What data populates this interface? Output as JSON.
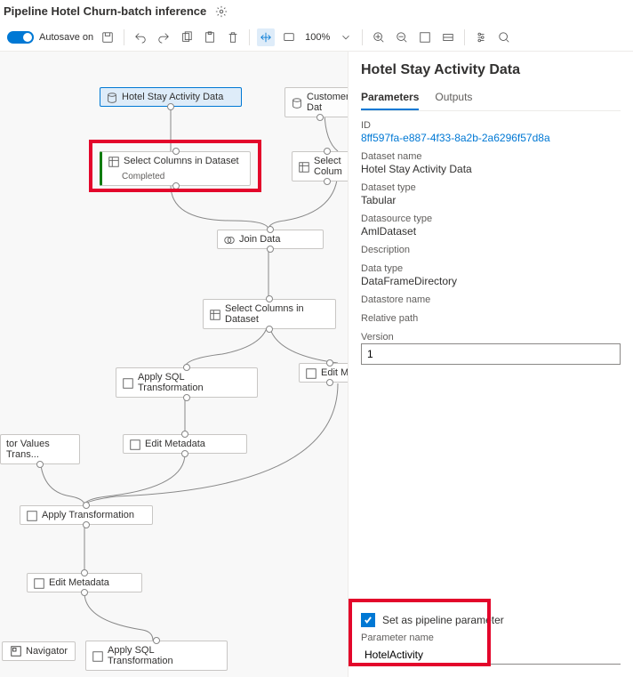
{
  "header": {
    "title": "Pipeline Hotel Churn-batch inference"
  },
  "toolbar": {
    "autosave_label": "Autosave on",
    "zoom": "100%"
  },
  "canvas": {
    "nodes": {
      "hotel_data": "Hotel Stay Activity Data",
      "customer_data": "Customer Dat",
      "select1": "Select Columns in Dataset",
      "select1_status": "Completed",
      "select2": "Select Colum",
      "join": "Join Data",
      "select3": "Select Columns in Dataset",
      "apply_sql1": "Apply SQL Transformation",
      "edit_m_right": "Edit M",
      "values_trans": "tor Values Trans...",
      "edit_meta1": "Edit Metadata",
      "apply_trans": "Apply Transformation",
      "edit_meta2": "Edit Metadata",
      "apply_sql2": "Apply SQL Transformation"
    },
    "navigator": "Navigator"
  },
  "side": {
    "title": "Hotel Stay Activity Data",
    "tabs": {
      "parameters": "Parameters",
      "outputs": "Outputs"
    },
    "props": {
      "id_k": "ID",
      "id_v": "8ff597fa-e887-4f33-8a2b-2a6296f57d8a",
      "dsname_k": "Dataset name",
      "dsname_v": "Hotel Stay Activity Data",
      "dstype_k": "Dataset type",
      "dstype_v": "Tabular",
      "srctype_k": "Datasource type",
      "srctype_v": "AmlDataset",
      "desc_k": "Description",
      "dtype_k": "Data type",
      "dtype_v": "DataFrameDirectory",
      "store_k": "Datastore name",
      "rel_k": "Relative path",
      "ver_k": "Version",
      "ver_v": "1"
    },
    "param": {
      "chk_label": "Set as pipeline parameter",
      "name_k": "Parameter name",
      "name_v": "HotelActivity"
    }
  }
}
